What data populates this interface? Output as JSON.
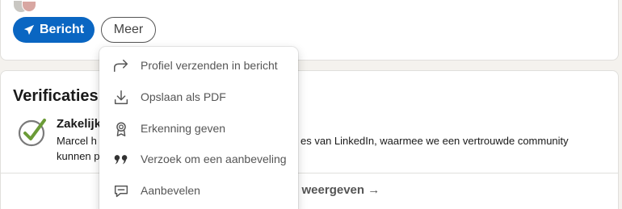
{
  "actions": {
    "message_label": "Bericht",
    "more_label": "Meer"
  },
  "verifications": {
    "title": "Verificaties",
    "item_name": "Zakelijk",
    "line1_start": "Marcel h",
    "line1_end": "es van LinkedIn, waarmee we een vertrouwde community",
    "line2": "kunnen p",
    "show_more": "s weergeven →"
  },
  "menu": {
    "items": [
      {
        "label": "Profiel verzenden in bericht",
        "icon": "share-arrow-icon"
      },
      {
        "label": "Opslaan als PDF",
        "icon": "download-icon"
      },
      {
        "label": "Erkenning geven",
        "icon": "award-ribbon-icon"
      },
      {
        "label": "Verzoek om een aanbeveling",
        "icon": "quote-icon"
      },
      {
        "label": "Aanbevelen",
        "icon": "speech-bubble-icon"
      }
    ]
  },
  "colors": {
    "primary": "#0a66c2",
    "verified_green": "#6b9b37",
    "background": "#f4f2ee"
  }
}
